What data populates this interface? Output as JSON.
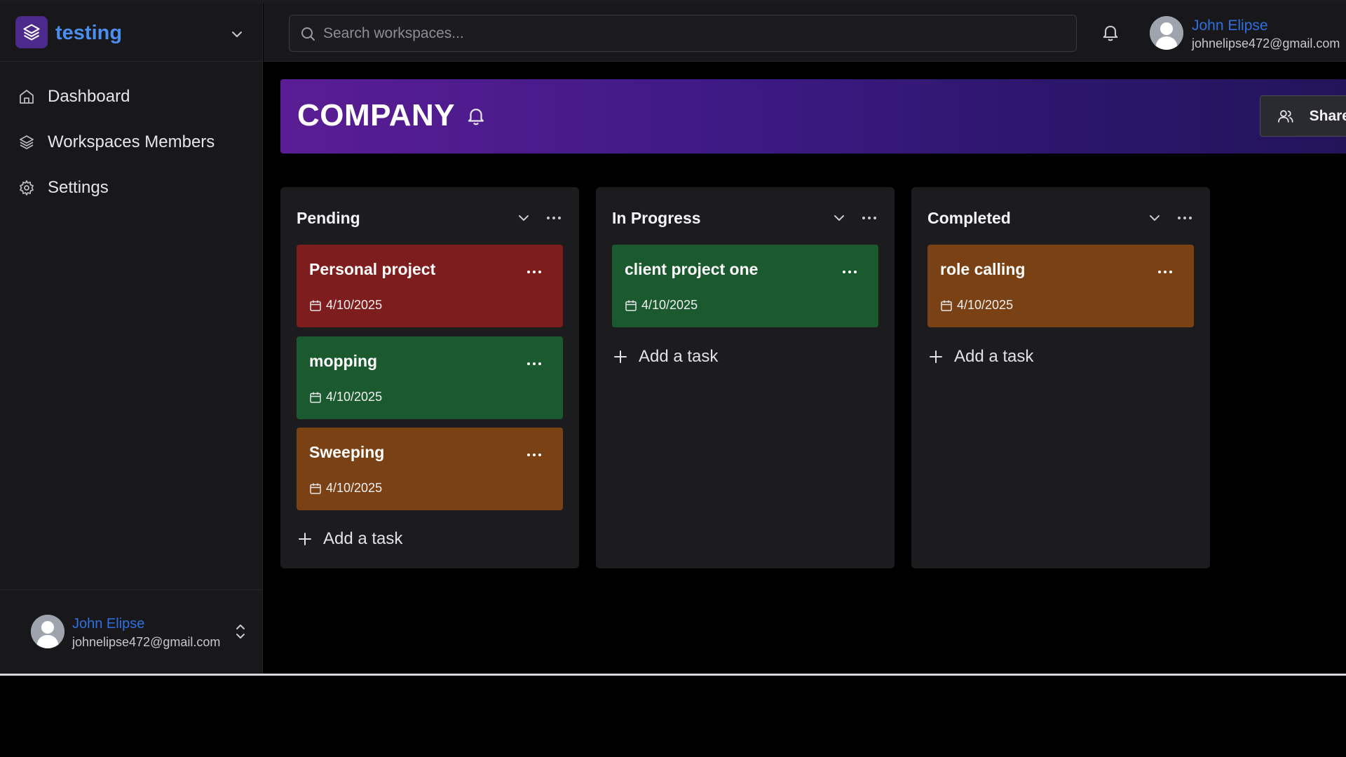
{
  "workspace": {
    "name": "testing"
  },
  "search": {
    "placeholder": "Search workspaces..."
  },
  "user": {
    "name": "John Elipse",
    "email": "johnelipse472@gmail.com"
  },
  "nav": {
    "items": [
      {
        "label": "Dashboard",
        "icon": "home-icon"
      },
      {
        "label": "Workspaces Members",
        "icon": "layers-icon"
      },
      {
        "label": "Settings",
        "icon": "gear-icon"
      }
    ]
  },
  "board": {
    "title": "COMPANY",
    "share_label": "Share",
    "add_task_label": "Add a task",
    "columns": [
      {
        "title": "Pending",
        "cards": [
          {
            "title": "Personal project",
            "date": "4/10/2025",
            "color": "#7e1d1d"
          },
          {
            "title": "mopping",
            "date": "4/10/2025",
            "color": "#1b5a2e"
          },
          {
            "title": "Sweeping",
            "date": "4/10/2025",
            "color": "#7a4214"
          }
        ]
      },
      {
        "title": "In Progress",
        "cards": [
          {
            "title": "client project one",
            "date": "4/10/2025",
            "color": "#1b5a2e"
          }
        ]
      },
      {
        "title": "Completed",
        "cards": [
          {
            "title": "role calling",
            "date": "4/10/2025",
            "color": "#7a4214"
          }
        ]
      }
    ]
  },
  "colors": {
    "accent": "#4c8df0",
    "link": "#2f6fe0",
    "banner_start": "#5a1d94",
    "banner_end": "#23145a"
  }
}
